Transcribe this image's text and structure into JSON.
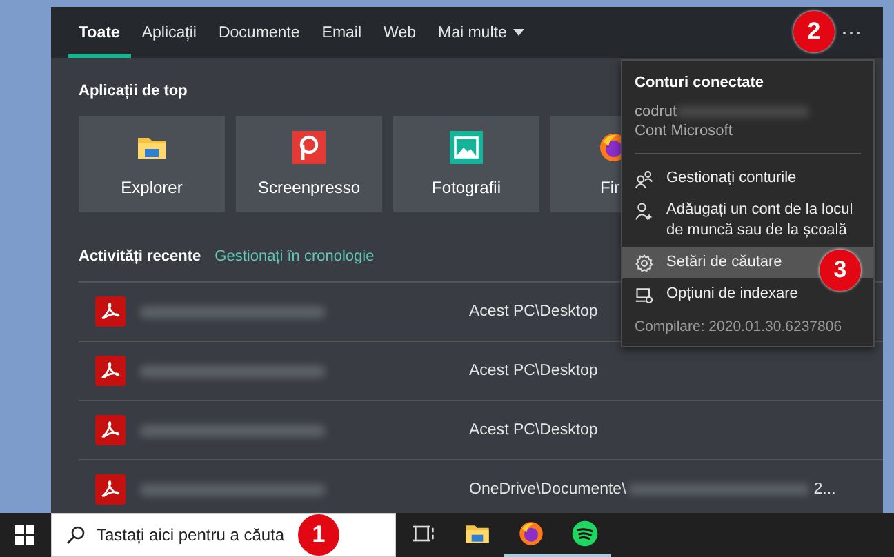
{
  "tabs": [
    {
      "label": "Toate",
      "selected": true,
      "kind": "plain"
    },
    {
      "label": "Aplicații",
      "selected": false,
      "kind": "plain"
    },
    {
      "label": "Documente",
      "selected": false,
      "kind": "plain"
    },
    {
      "label": "Email",
      "selected": false,
      "kind": "plain"
    },
    {
      "label": "Web",
      "selected": false,
      "kind": "plain"
    },
    {
      "label": "Mai multe",
      "selected": false,
      "kind": "dropdown"
    }
  ],
  "top_apps": {
    "title": "Aplicații de top",
    "apps": [
      {
        "name": "Explorer",
        "kind": "explorer"
      },
      {
        "name": "Screenpresso",
        "kind": "screenpresso"
      },
      {
        "name": "Fotografii",
        "kind": "photos"
      },
      {
        "name": "Fir",
        "kind": "firefox"
      }
    ]
  },
  "recent": {
    "title": "Activități recente",
    "link": "Gestionați în cronologie",
    "rows": [
      {
        "location": "Acest PC\\Desktop"
      },
      {
        "location": "Acest PC\\Desktop"
      },
      {
        "location": "Acest PC\\Desktop"
      },
      {
        "location": "OneDrive\\Documente\\",
        "suffix": "2..."
      }
    ]
  },
  "menu": {
    "title": "Conturi conectate",
    "account": "codrut",
    "account_type": "Cont Microsoft",
    "items": [
      {
        "label": "Gestionați conturile",
        "kind": "people",
        "selected": false
      },
      {
        "label": "Adăugați un cont de la locul de muncă sau de la școală",
        "kind": "add-person",
        "selected": false
      },
      {
        "label": "Setări de căutare",
        "kind": "gear",
        "selected": true
      },
      {
        "label": "Opțiuni de indexare",
        "kind": "index",
        "selected": false
      }
    ],
    "build": "Compilare: 2020.01.30.6237806"
  },
  "taskbar": {
    "search_placeholder": "Tastați aici pentru a căuta",
    "apps": [
      {
        "kind": "task-view",
        "running": false
      },
      {
        "kind": "explorer",
        "running": false
      },
      {
        "kind": "firefox",
        "running": true
      },
      {
        "kind": "spotify",
        "running": true
      }
    ]
  },
  "callouts": [
    "1",
    "2",
    "3"
  ]
}
